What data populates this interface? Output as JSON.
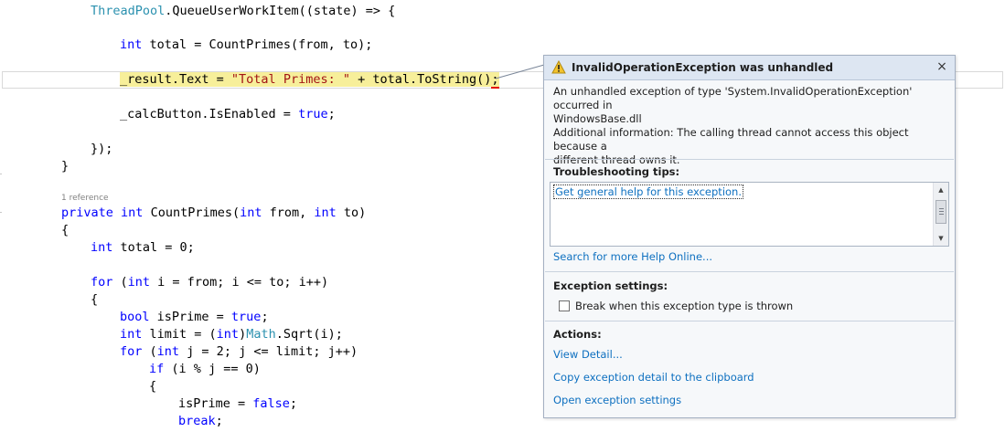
{
  "code": {
    "line1": {
      "cls": "ThreadPool",
      "text": ".QueueUserWorkItem((state) => {"
    },
    "line2": {
      "kw": "int",
      "text": " total = CountPrimes(from, to);"
    },
    "line3": {
      "pre": "_result.Text = ",
      "str": "\"Total Primes: \"",
      "post": " + total.ToString()",
      "err": ";"
    },
    "line4": {
      "pre": "_calcButton.IsEnabled = ",
      "kw": "true",
      "post": ";"
    },
    "line5": "});",
    "line6": "}",
    "codelens": "1 reference",
    "line7": {
      "kw1": "private",
      "sp1": " ",
      "kw2": "int",
      "mid": " CountPrimes(",
      "kw3": "int",
      "mid2": " from, ",
      "kw4": "int",
      "end": " to)"
    },
    "line8": "{",
    "line9": {
      "kw": "int",
      "text": " total = 0;"
    },
    "line10": {
      "kw": "for",
      "a": " (",
      "kw2": "int",
      "b": " i = from; i <= to; i++)"
    },
    "line11": "{",
    "line12": {
      "kw": "bool",
      "a": " isPrime = ",
      "kw2": "true",
      "b": ";"
    },
    "line13": {
      "kw": "int",
      "a": " limit = (",
      "kw2": "int",
      "b": ")",
      "cls": "Math",
      "c": ".Sqrt(i);"
    },
    "line14": {
      "kw": "for",
      "a": " (",
      "kw2": "int",
      "b": " j = 2; j <= limit; j++)"
    },
    "line15": {
      "kw": "if",
      "a": " (i % j == 0)"
    },
    "line16": "{",
    "line17": {
      "a": "isPrime = ",
      "kw": "false",
      "b": ";"
    },
    "line18": {
      "kw": "break",
      "b": ";"
    }
  },
  "exception": {
    "title": "InvalidOperationException was unhandled",
    "close_glyph": "×",
    "message_l1": "An unhandled exception of type 'System.InvalidOperationException' occurred in",
    "message_l2": "WindowsBase.dll",
    "info_l1": "Additional information: The calling thread cannot access this object because a",
    "info_l2": "different thread owns it.",
    "tips_title": "Troubleshooting tips:",
    "tips_link": "Get general help for this exception.",
    "search_online": "Search for more Help Online...",
    "settings_title": "Exception settings:",
    "break_label": "Break when this exception type is thrown",
    "break_checked": false,
    "actions_title": "Actions:",
    "actions": [
      "View Detail...",
      "Copy exception detail to the clipboard",
      "Open exception settings"
    ]
  },
  "colors": {
    "keyword": "#0000ff",
    "type": "#2b91af",
    "string": "#a31515",
    "highlight": "#f7ef9a",
    "link": "#0e70c0",
    "warning": "#f2c22d"
  },
  "icons": {
    "warning": "warning-icon",
    "close": "close-icon",
    "scroll_up": "scroll-up-icon",
    "scroll_down": "scroll-down-icon"
  }
}
